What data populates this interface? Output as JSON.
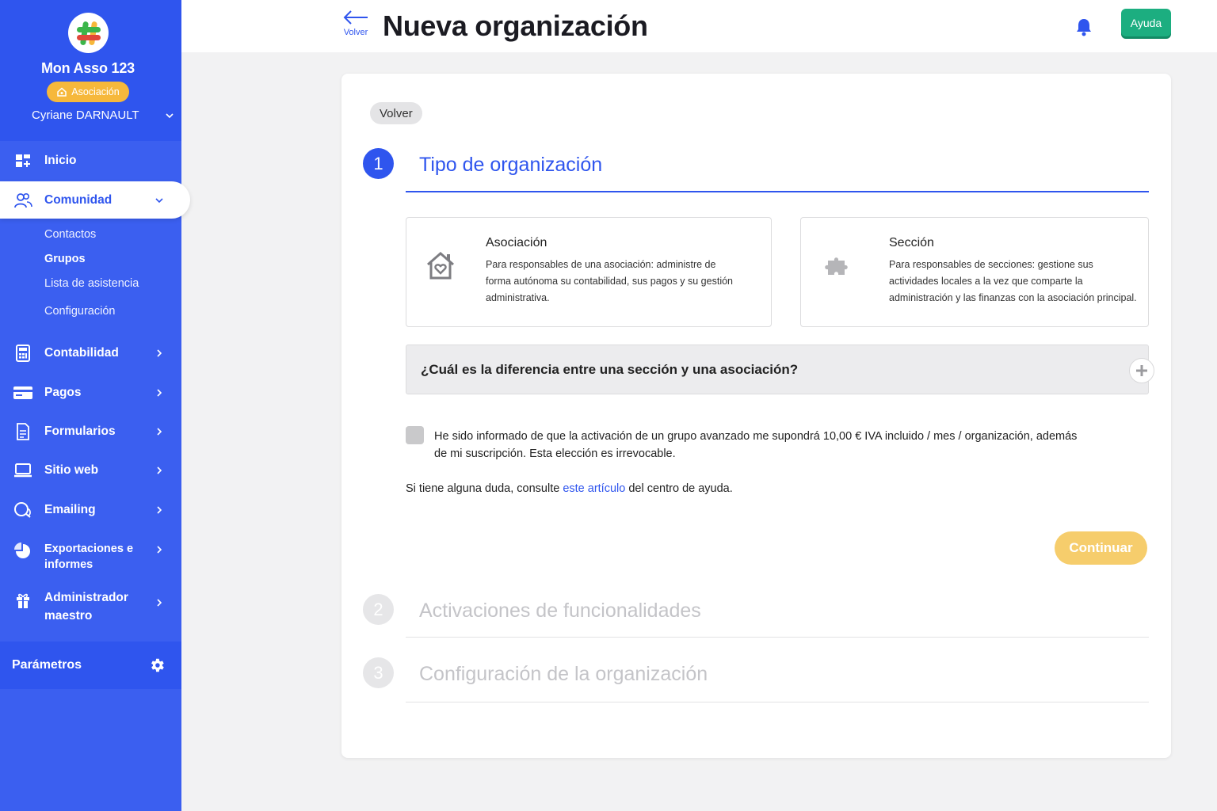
{
  "sidebar": {
    "org_name": "Mon Asso 123",
    "org_badge": "Asociación",
    "user_name": "Cyriane DARNAULT",
    "nav": [
      {
        "label": "Inicio",
        "icon": "dashboard-icon"
      },
      {
        "label": "Comunidad",
        "icon": "users-icon"
      },
      {
        "label": "Contabilidad",
        "icon": "calculator-icon"
      },
      {
        "label": "Pagos",
        "icon": "credit-card-icon"
      },
      {
        "label": "Formularios",
        "icon": "document-icon"
      },
      {
        "label": "Sitio web",
        "icon": "laptop-icon"
      },
      {
        "label": "Emailing",
        "icon": "chat-icon"
      },
      {
        "label_line1": "Exportaciones e",
        "label_line2": "informes",
        "icon": "pie-chart-icon"
      },
      {
        "label_line1": "Administrador",
        "label_line2": "maestro",
        "icon": "gift-icon"
      }
    ],
    "sub_items": [
      "Contactos",
      "Grupos",
      "Lista de asistencia",
      "Configuración"
    ],
    "params_label": "Parámetros"
  },
  "topbar": {
    "back_label": "Volver",
    "title": "Nueva organización",
    "help_label": "Ayuda"
  },
  "card": {
    "back_chip": "Volver",
    "steps": [
      {
        "number": "1",
        "title": "Tipo de organización",
        "active": true
      },
      {
        "number": "2",
        "title": "Activaciones de funcionalidades",
        "active": false
      },
      {
        "number": "3",
        "title": "Configuración de la organización",
        "active": false
      }
    ],
    "options": [
      {
        "title": "Asociación",
        "desc": "Para responsables de una asociación: administre de forma autónoma su contabilidad, sus pagos y su gestión administrativa.",
        "icon": "house-heart-icon"
      },
      {
        "title": "Sección",
        "desc": "Para responsables de secciones: gestione sus actividades locales a la vez que comparte la administración y las finanzas con la asociación principal.",
        "icon": "puzzle-icon"
      }
    ],
    "faq_question": "¿Cuál es la diferencia entre una sección y una asociación?",
    "checkbox_text": "He sido informado de que la activación de un grupo avanzado me supondrá 10,00 € IVA incluido / mes / organización, además de mi suscripción. Esta elección es irrevocable.",
    "help_prefix": "Si tiene alguna duda, consulte ",
    "help_link": "este artículo",
    "help_suffix": " del centro de ayuda.",
    "continue_label": "Continuar"
  },
  "colors": {
    "primary": "#2f55ee",
    "sidebar": "#3b5ff0",
    "help_green": "#1cae80",
    "badge_orange": "#f6b83b",
    "continue_yellow": "#f6cd6c"
  }
}
